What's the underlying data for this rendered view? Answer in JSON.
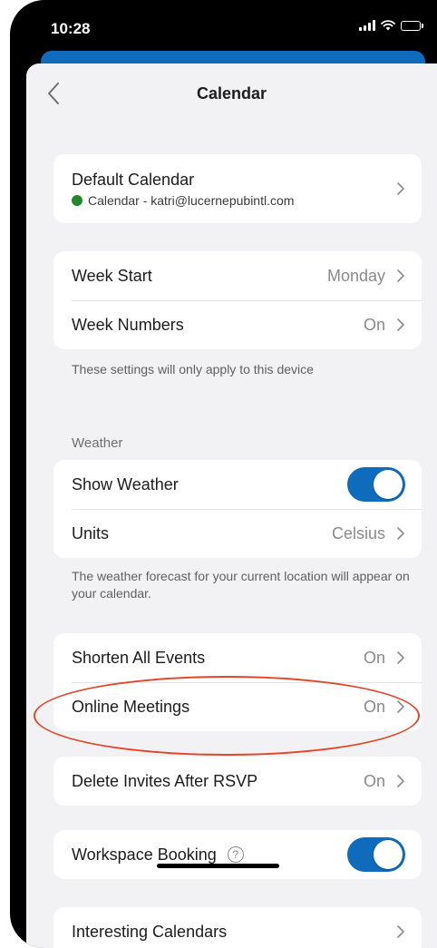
{
  "status_bar": {
    "time": "10:28"
  },
  "nav": {
    "title": "Calendar"
  },
  "default_calendar": {
    "label": "Default Calendar",
    "sub": "Calendar - katri@lucernepubintl.com"
  },
  "week": {
    "start_label": "Week Start",
    "start_value": "Monday",
    "numbers_label": "Week Numbers",
    "numbers_value": "On",
    "note": "These settings will only apply to this device"
  },
  "weather": {
    "header": "Weather",
    "show_label": "Show Weather",
    "show_on": true,
    "units_label": "Units",
    "units_value": "Celsius",
    "note": "The weather forecast for your current location will appear on your calendar."
  },
  "events": {
    "shorten_label": "Shorten All Events",
    "shorten_value": "On",
    "online_label": "Online Meetings",
    "online_value": "On"
  },
  "delete_invites": {
    "label": "Delete Invites After RSVP",
    "value": "On"
  },
  "workspace": {
    "label": "Workspace Booking",
    "on": true,
    "help_glyph": "?"
  },
  "interesting": {
    "label": "Interesting Calendars"
  },
  "colors": {
    "accent": "#0f6cbd",
    "calendar_dot": "#22862b",
    "highlight": "#e0462a"
  }
}
